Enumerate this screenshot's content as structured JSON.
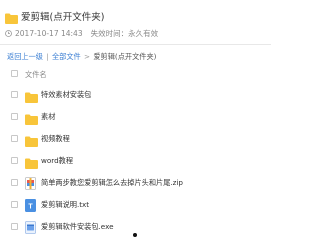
{
  "header": {
    "title": "爱剪辑(点开文件夹)",
    "date": "2017-10-17 14:43",
    "expire_label": "失效时间：永久有效"
  },
  "breadcrumb": {
    "back": "返回上一级",
    "separator": "|",
    "all_files": "全部文件",
    "arrow": ">",
    "current": "爱剪辑(点开文件夹)"
  },
  "list": {
    "column_name": "文件名",
    "items": [
      {
        "name": "特效素材安装包",
        "type": "folder"
      },
      {
        "name": "素材",
        "type": "folder"
      },
      {
        "name": "视频教程",
        "type": "folder"
      },
      {
        "name": "word教程",
        "type": "folder"
      },
      {
        "name": "简单两步教您爱剪辑怎么去掉片头和片尾.zip",
        "type": "zip"
      },
      {
        "name": "爱剪辑说明.txt",
        "type": "txt"
      },
      {
        "name": "爱剪辑软件安装包.exe",
        "type": "exe"
      }
    ]
  },
  "colors": {
    "folder": "#f8c53a",
    "link": "#3a7ed3",
    "txt": "#4a90e2",
    "exe": "#6aa0ea"
  }
}
